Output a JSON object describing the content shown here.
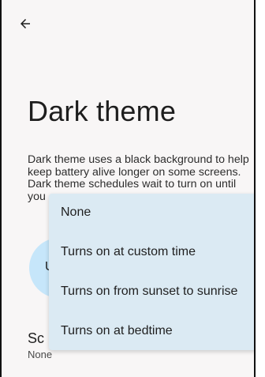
{
  "header": {
    "back_icon": "arrow-back-icon"
  },
  "page": {
    "title": "Dark theme",
    "description": "Dark theme uses a black background to help keep battery alive longer on some screens. Dark theme schedules wait to turn on until you"
  },
  "primary_button": {
    "label": "U"
  },
  "schedule": {
    "title": "Sc",
    "value": "None"
  },
  "dropdown": {
    "options": [
      {
        "label": "None"
      },
      {
        "label": "Turns on at custom time"
      },
      {
        "label": "Turns on from sunset to sunrise"
      },
      {
        "label": "Turns on at bedtime"
      }
    ]
  },
  "colors": {
    "background": "#f8f6f6",
    "menu_background": "#dbeaf3",
    "button_background": "#c6e6fa",
    "text_primary": "#1e1e1e"
  }
}
